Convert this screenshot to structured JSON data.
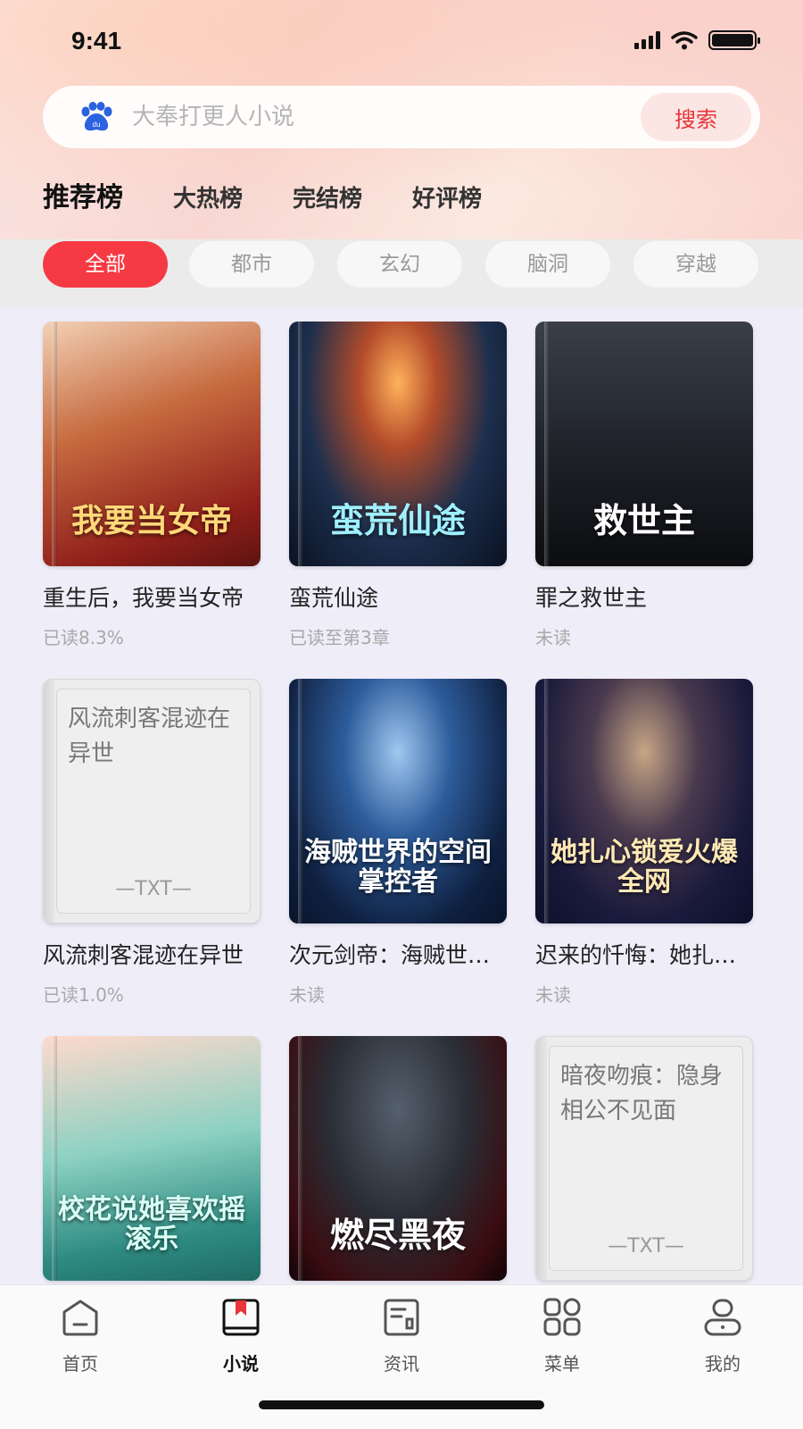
{
  "status_bar": {
    "time": "9:41"
  },
  "search": {
    "placeholder": "大奉打更人小说",
    "button_label": "搜索",
    "logo_icon": "baidu-paw-icon"
  },
  "rank_tabs": [
    {
      "label": "推荐榜",
      "active": true
    },
    {
      "label": "大热榜",
      "active": false
    },
    {
      "label": "完结榜",
      "active": false
    },
    {
      "label": "好评榜",
      "active": false
    }
  ],
  "category_chips": [
    {
      "label": "全部",
      "active": true
    },
    {
      "label": "都市",
      "active": false
    },
    {
      "label": "玄幻",
      "active": false
    },
    {
      "label": "脑洞",
      "active": false
    },
    {
      "label": "穿越",
      "active": false
    }
  ],
  "books": [
    {
      "name": "重生后，我要当女帝",
      "progress": "已读8.3%",
      "cover_text": "我要当女帝",
      "cover_type": "image"
    },
    {
      "name": "蛮荒仙途",
      "progress": "已读至第3章",
      "cover_text": "蛮荒仙途",
      "cover_type": "image"
    },
    {
      "name": "罪之救世主",
      "progress": "未读",
      "cover_text": "救世主",
      "cover_type": "image"
    },
    {
      "name": "风流刺客混迹在异世",
      "progress": "已读1.0%",
      "cover_text": "风流刺客混迹在异世",
      "cover_type": "txt",
      "txt_mark": "—TXT—"
    },
    {
      "name": "次元剑帝：海贼世界的空间掌控者",
      "progress": "未读",
      "cover_text": "海贼世界的空间掌控者",
      "cover_type": "image"
    },
    {
      "name": "迟来的忏悔：她扎心锁爱火爆全网",
      "progress": "未读",
      "cover_text": "她扎心锁爱火爆全网",
      "cover_type": "image"
    },
    {
      "name": "校花说她喜欢摇滚乐",
      "progress": "",
      "cover_text": "校花说她喜欢摇滚乐",
      "cover_type": "image"
    },
    {
      "name": "燃尽黑夜",
      "progress": "",
      "cover_text": "燃尽黑夜",
      "cover_type": "image"
    },
    {
      "name": "暗夜吻痕：隐身相公不见面",
      "progress": "",
      "cover_text": "暗夜吻痕：隐身相公不见面",
      "cover_type": "txt",
      "txt_mark": "—TXT—"
    }
  ],
  "tab_bar": [
    {
      "label": "首页",
      "icon": "home-icon",
      "active": false
    },
    {
      "label": "小说",
      "icon": "book-icon",
      "active": true
    },
    {
      "label": "资讯",
      "icon": "news-icon",
      "active": false
    },
    {
      "label": "菜单",
      "icon": "grid-menu-icon",
      "active": false
    },
    {
      "label": "我的",
      "icon": "profile-icon",
      "active": false
    }
  ],
  "colors": {
    "accent": "#f63a43",
    "search_button_text": "#e8343a"
  }
}
